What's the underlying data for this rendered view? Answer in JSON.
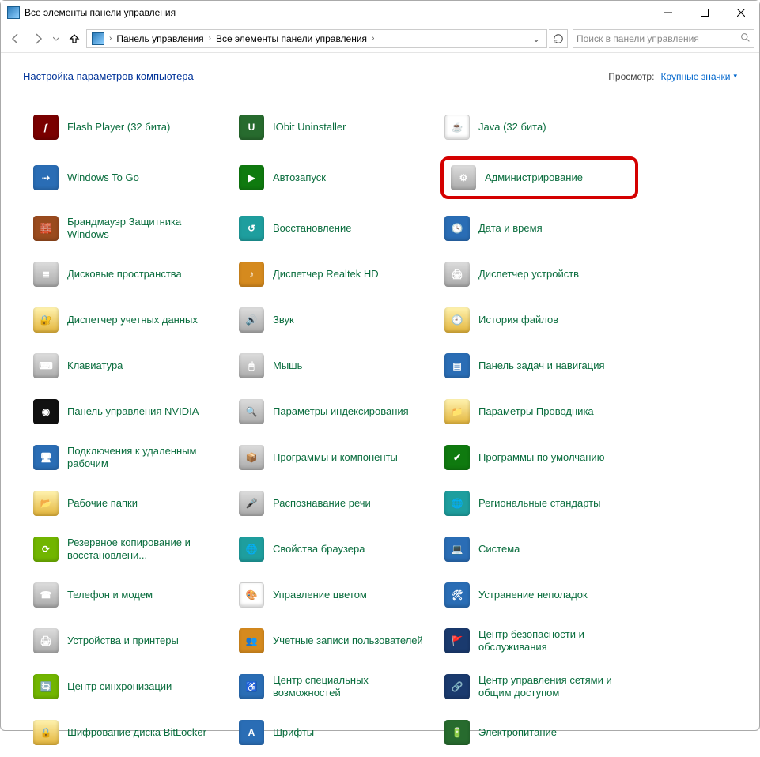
{
  "window": {
    "title": "Все элементы панели управления"
  },
  "nav": {
    "breadcrumb": [
      "Панель управления",
      "Все элементы панели управления"
    ],
    "search_placeholder": "Поиск в панели управления"
  },
  "header": {
    "title": "Настройка параметров компьютера",
    "view_label": "Просмотр:",
    "view_value": "Крупные значки"
  },
  "items": [
    {
      "label": "Flash Player (32 бита)",
      "icon": "flash",
      "cls": "c-red",
      "glyph": "ƒ"
    },
    {
      "label": "IObit Uninstaller",
      "icon": "iobit",
      "cls": "c-dgreen",
      "glyph": "U"
    },
    {
      "label": "Java (32 бита)",
      "icon": "java",
      "cls": "c-white",
      "glyph": "☕"
    },
    {
      "label": "Windows To Go",
      "icon": "wtg",
      "cls": "c-blue",
      "glyph": "⇢"
    },
    {
      "label": "Автозапуск",
      "icon": "autorun",
      "cls": "c-green",
      "glyph": "▶"
    },
    {
      "label": "Администрирование",
      "icon": "admin",
      "cls": "c-gray",
      "glyph": "⚙",
      "highlight": true
    },
    {
      "label": "Брандмауэр Защитника Windows",
      "icon": "firewall",
      "cls": "c-brick",
      "glyph": "🧱"
    },
    {
      "label": "Восстановление",
      "icon": "recovery",
      "cls": "c-teal",
      "glyph": "↺"
    },
    {
      "label": "Дата и время",
      "icon": "datetime",
      "cls": "c-blue",
      "glyph": "🕓"
    },
    {
      "label": "Дисковые пространства",
      "icon": "storage",
      "cls": "c-gray",
      "glyph": "≣"
    },
    {
      "label": "Диспетчер Realtek HD",
      "icon": "realtek",
      "cls": "c-orange",
      "glyph": "♪"
    },
    {
      "label": "Диспетчер устройств",
      "icon": "devmgr",
      "cls": "c-gray",
      "glyph": "🖨"
    },
    {
      "label": "Диспетчер учетных данных",
      "icon": "cred",
      "cls": "c-ygrad",
      "glyph": "🔐"
    },
    {
      "label": "Звук",
      "icon": "sound",
      "cls": "c-gray",
      "glyph": "🔊"
    },
    {
      "label": "История файлов",
      "icon": "filehist",
      "cls": "c-ygrad",
      "glyph": "🕘"
    },
    {
      "label": "Клавиатура",
      "icon": "keyboard",
      "cls": "c-gray",
      "glyph": "⌨"
    },
    {
      "label": "Мышь",
      "icon": "mouse",
      "cls": "c-gray",
      "glyph": "🖱"
    },
    {
      "label": "Панель задач и навигация",
      "icon": "taskbar",
      "cls": "c-blue",
      "glyph": "▤"
    },
    {
      "label": "Панель управления NVIDIA",
      "icon": "nvidia",
      "cls": "c-black",
      "glyph": "◉"
    },
    {
      "label": "Параметры индексирования",
      "icon": "index",
      "cls": "c-gray",
      "glyph": "🔍"
    },
    {
      "label": "Параметры Проводника",
      "icon": "explorer",
      "cls": "c-ygrad",
      "glyph": "📁"
    },
    {
      "label": "Подключения к удаленным рабочим",
      "icon": "remote",
      "cls": "c-blue",
      "glyph": "🖥"
    },
    {
      "label": "Программы и компоненты",
      "icon": "programs",
      "cls": "c-gray",
      "glyph": "📦"
    },
    {
      "label": "Программы по умолчанию",
      "icon": "defaults",
      "cls": "c-green",
      "glyph": "✔"
    },
    {
      "label": "Рабочие папки",
      "icon": "workfolders",
      "cls": "c-ygrad",
      "glyph": "📂"
    },
    {
      "label": "Распознавание речи",
      "icon": "speech",
      "cls": "c-gray",
      "glyph": "🎤"
    },
    {
      "label": "Региональные стандарты",
      "icon": "region",
      "cls": "c-teal",
      "glyph": "🌐"
    },
    {
      "label": "Резервное копирование и восстановлени...",
      "icon": "backup",
      "cls": "c-lime",
      "glyph": "⟳"
    },
    {
      "label": "Свойства браузера",
      "icon": "inetopt",
      "cls": "c-teal",
      "glyph": "🌐"
    },
    {
      "label": "Система",
      "icon": "system",
      "cls": "c-blue",
      "glyph": "💻"
    },
    {
      "label": "Телефон и модем",
      "icon": "phone",
      "cls": "c-gray",
      "glyph": "☎"
    },
    {
      "label": "Управление цветом",
      "icon": "color",
      "cls": "c-white",
      "glyph": "🎨"
    },
    {
      "label": "Устранение неполадок",
      "icon": "trouble",
      "cls": "c-blue",
      "glyph": "🛠"
    },
    {
      "label": "Устройства и принтеры",
      "icon": "devices",
      "cls": "c-gray",
      "glyph": "🖨"
    },
    {
      "label": "Учетные записи пользователей",
      "icon": "users",
      "cls": "c-orange",
      "glyph": "👥"
    },
    {
      "label": "Центр безопасности и обслуживания",
      "icon": "security",
      "cls": "c-navy",
      "glyph": "🚩"
    },
    {
      "label": "Центр синхронизации",
      "icon": "sync",
      "cls": "c-lime",
      "glyph": "🔄"
    },
    {
      "label": "Центр специальных возможностей",
      "icon": "ease",
      "cls": "c-blue",
      "glyph": "♿"
    },
    {
      "label": "Центр управления сетями и общим доступом",
      "icon": "network",
      "cls": "c-navy",
      "glyph": "🔗"
    },
    {
      "label": "Шифрование диска BitLocker",
      "icon": "bitlocker",
      "cls": "c-ygrad",
      "glyph": "🔒"
    },
    {
      "label": "Шрифты",
      "icon": "fonts",
      "cls": "c-blue",
      "glyph": "A"
    },
    {
      "label": "Электропитание",
      "icon": "power",
      "cls": "c-dgreen",
      "glyph": "🔋"
    }
  ]
}
